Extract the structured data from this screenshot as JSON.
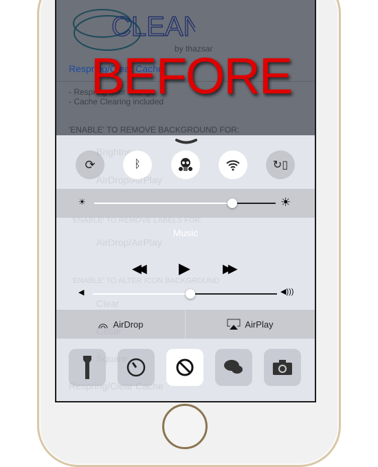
{
  "overlay": {
    "before_label": "BEFORE"
  },
  "settings": {
    "logo_text": "CLEAN",
    "byline": "by thazsar",
    "respring_link": "Respring/Clear Cache",
    "notes": [
      "- Respring after change",
      "- Cache Clearing included"
    ],
    "section_background": "'ENABLE' TO REMOVE BACKGROUND FOR:",
    "ghost_rows": [
      "Brightness",
      "AirDrop/AirPlay",
      "'ENABLE' TO REMOVE LABELS FOR:",
      "AirDrop/AirPlay",
      "'ENABLE' TO ALTER ICON BACKGROUND",
      "Clear",
      "Circle",
      "Square",
      "Respring/Clear Cache"
    ]
  },
  "control_center": {
    "toggles": [
      {
        "name": "rotation-lock",
        "on": false
      },
      {
        "name": "bluetooth",
        "on": true
      },
      {
        "name": "gas-mask",
        "on": true
      },
      {
        "name": "wifi",
        "on": true
      },
      {
        "name": "rotate-device",
        "on": false
      }
    ],
    "brightness": 0.76,
    "music_label": "Music",
    "volume": 0.53,
    "airdrop_label": "AirDrop",
    "airplay_label": "AirPlay",
    "shortcuts": [
      {
        "name": "flashlight",
        "on": false
      },
      {
        "name": "timer",
        "on": false
      },
      {
        "name": "do-not-disturb",
        "on": true
      },
      {
        "name": "messages",
        "on": false
      },
      {
        "name": "camera",
        "on": false
      }
    ]
  }
}
